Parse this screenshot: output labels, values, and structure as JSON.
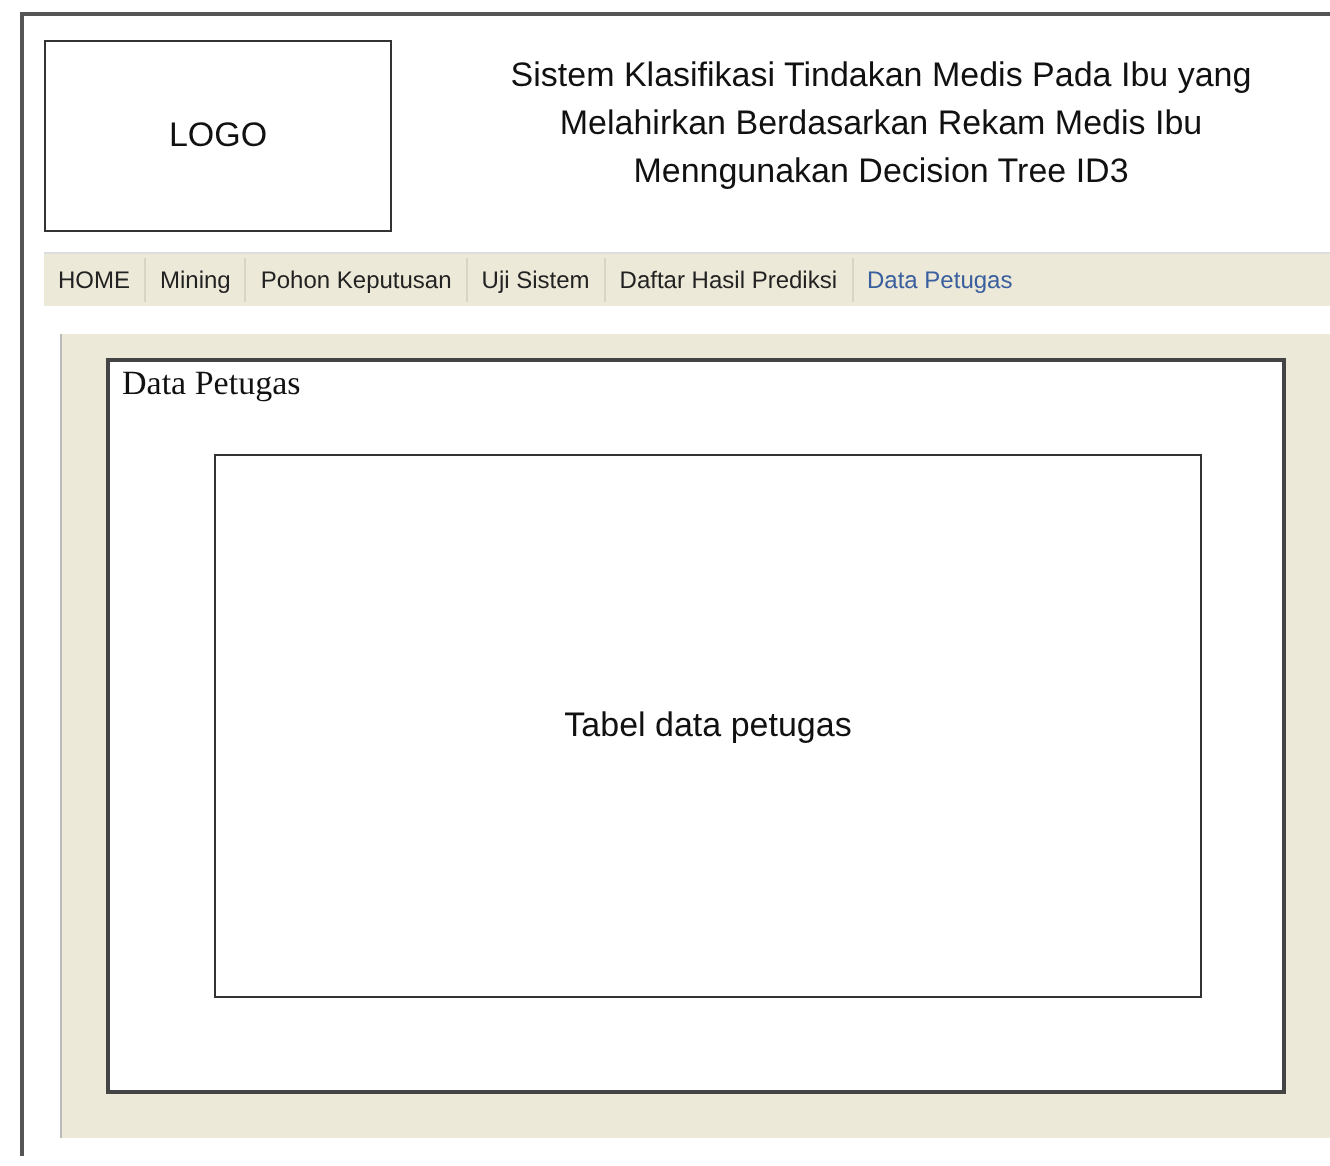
{
  "header": {
    "logo": "LOGO",
    "title": "Sistem Klasifikasi Tindakan Medis Pada Ibu yang Melahirkan Berdasarkan Rekam Medis Ibu Menngunakan Decision Tree ID3"
  },
  "nav": [
    {
      "label": "HOME",
      "selected": false
    },
    {
      "label": "Mining",
      "selected": false
    },
    {
      "label": "Pohon Keputusan",
      "selected": false
    },
    {
      "label": "Uji Sistem",
      "selected": false
    },
    {
      "label": "Daftar Hasil Prediksi",
      "selected": false
    },
    {
      "label": "Data Petugas",
      "selected": true
    }
  ],
  "content": {
    "heading": "Data Petugas",
    "table_placeholder": "Tabel data petugas"
  }
}
